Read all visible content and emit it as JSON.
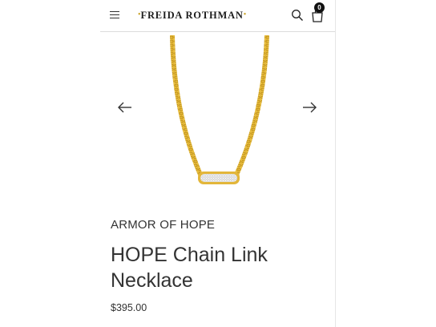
{
  "header": {
    "logo_text": "FREIDA ROTHMAN",
    "cart_count": "0"
  },
  "icons": {
    "menu": "hamburger-menu-icon",
    "search": "search-icon",
    "cart": "shopping-bag-icon",
    "prev": "arrow-left-icon",
    "next": "arrow-right-icon"
  },
  "product": {
    "collection": "ARMOR OF HOPE",
    "name": "HOPE Chain Link Necklace",
    "price": "$395.00"
  },
  "colors": {
    "gold": "#e3b63a",
    "logo_dot": "#c9a227",
    "text": "#333333"
  }
}
